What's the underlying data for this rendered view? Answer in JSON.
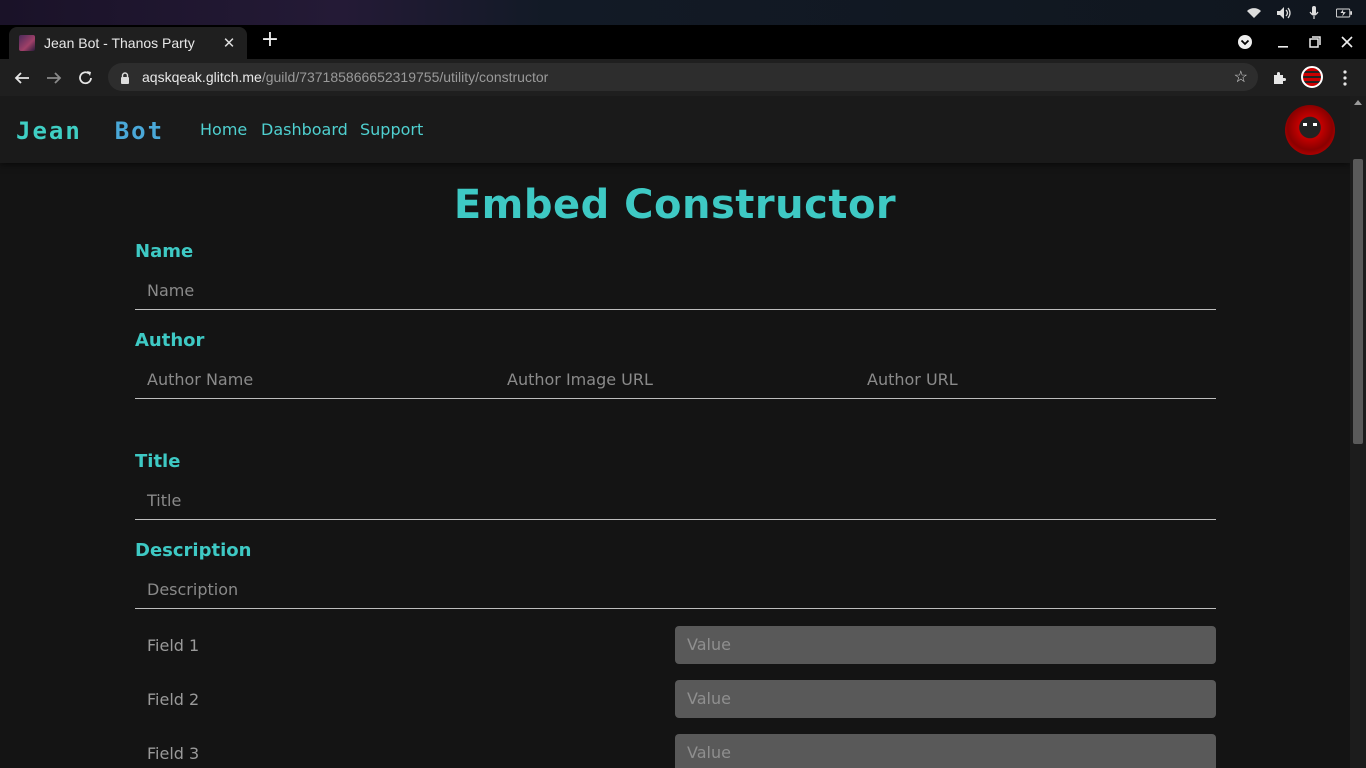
{
  "browser": {
    "tab_title": "Jean Bot - Thanos Party",
    "url_host": "aqskqeak.glitch.me",
    "url_path": "/guild/737185866652319755/utility/constructor"
  },
  "site": {
    "logo_first": "Jean",
    "logo_second": "Bot",
    "nav": [
      "Home",
      "Dashboard",
      "Support"
    ],
    "accent_color": "#3ec9c4"
  },
  "page": {
    "heading": "Embed Constructor",
    "name_label": "Name",
    "name_placeholder": "Name",
    "author_label": "Author",
    "author_name_placeholder": "Author Name",
    "author_image_placeholder": "Author Image URL",
    "author_url_placeholder": "Author URL",
    "title_label": "Title",
    "title_placeholder": "Title",
    "description_label": "Description",
    "description_placeholder": "Description",
    "fields": [
      {
        "name": "Field 1",
        "value_placeholder": "Value"
      },
      {
        "name": "Field 2",
        "value_placeholder": "Value"
      },
      {
        "name": "Field 3",
        "value_placeholder": "Value"
      }
    ]
  }
}
